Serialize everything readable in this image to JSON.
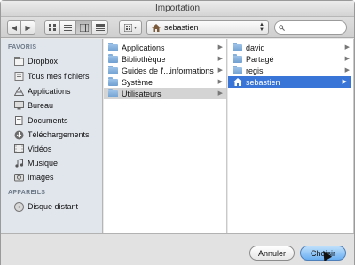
{
  "window": {
    "title": "Importation"
  },
  "toolbar": {
    "back": "◀",
    "forward": "▶",
    "location": "sebastien",
    "search_placeholder": ""
  },
  "sidebar": {
    "favorites_header": "FAVORIS",
    "favorites": [
      {
        "label": "Dropbox",
        "icon": "dropbox-icon"
      },
      {
        "label": "Tous mes fichiers",
        "icon": "all-files-icon"
      },
      {
        "label": "Applications",
        "icon": "applications-icon"
      },
      {
        "label": "Bureau",
        "icon": "desktop-icon"
      },
      {
        "label": "Documents",
        "icon": "documents-icon"
      },
      {
        "label": "Téléchargements",
        "icon": "downloads-icon"
      },
      {
        "label": "Vidéos",
        "icon": "videos-icon"
      },
      {
        "label": "Musique",
        "icon": "music-icon"
      },
      {
        "label": "Images",
        "icon": "images-icon"
      }
    ],
    "devices_header": "APPAREILS",
    "devices": [
      {
        "label": "Disque distant",
        "icon": "remote-disk-icon"
      }
    ]
  },
  "column1": {
    "items": [
      {
        "label": "Applications"
      },
      {
        "label": "Bibliothèque"
      },
      {
        "label": "Guides de l'...informations"
      },
      {
        "label": "Système"
      },
      {
        "label": "Utilisateurs"
      }
    ]
  },
  "column2": {
    "items": [
      {
        "label": "david"
      },
      {
        "label": "Partagé"
      },
      {
        "label": "regis"
      },
      {
        "label": "sebastien"
      }
    ]
  },
  "footer": {
    "cancel_label": "Annuler",
    "choose_label": "Choisir"
  }
}
